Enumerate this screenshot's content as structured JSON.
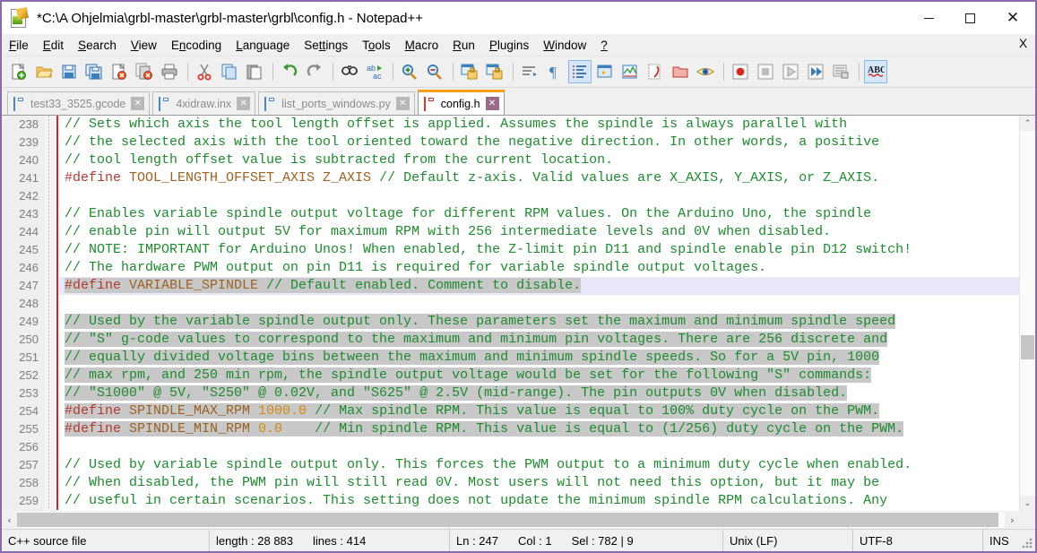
{
  "window": {
    "title": "*C:\\A Ohjelmia\\grbl-master\\grbl-master\\grbl\\config.h - Notepad++",
    "icon": "notepad-plus-plus-icon",
    "minimize_label": "—",
    "maximize_label": "□",
    "close_label": "✕"
  },
  "menu": {
    "items": [
      {
        "label": "File",
        "accel": "F"
      },
      {
        "label": "Edit",
        "accel": "E"
      },
      {
        "label": "Search",
        "accel": "S"
      },
      {
        "label": "View",
        "accel": "V"
      },
      {
        "label": "Encoding",
        "accel": "n"
      },
      {
        "label": "Language",
        "accel": "L"
      },
      {
        "label": "Settings",
        "accel": "t"
      },
      {
        "label": "Tools",
        "accel": "o"
      },
      {
        "label": "Macro",
        "accel": "M"
      },
      {
        "label": "Run",
        "accel": "R"
      },
      {
        "label": "Plugins",
        "accel": "P"
      },
      {
        "label": "Window",
        "accel": "W"
      },
      {
        "label": "?",
        "accel": "?"
      }
    ],
    "close_doc_label": "X"
  },
  "toolbar": {
    "buttons": [
      {
        "name": "new-file-icon",
        "tip": "New"
      },
      {
        "name": "open-file-icon",
        "tip": "Open"
      },
      {
        "name": "save-icon",
        "tip": "Save"
      },
      {
        "name": "save-all-icon",
        "tip": "Save All"
      },
      {
        "name": "close-file-icon",
        "tip": "Close"
      },
      {
        "name": "close-all-files-icon",
        "tip": "Close All"
      },
      {
        "name": "print-icon",
        "tip": "Print"
      },
      {
        "separator": true
      },
      {
        "name": "cut-icon",
        "tip": "Cut"
      },
      {
        "name": "copy-icon",
        "tip": "Copy"
      },
      {
        "name": "paste-icon",
        "tip": "Paste"
      },
      {
        "separator": true
      },
      {
        "name": "undo-icon",
        "tip": "Undo"
      },
      {
        "name": "redo-icon",
        "tip": "Redo"
      },
      {
        "separator": true
      },
      {
        "name": "find-icon",
        "tip": "Find"
      },
      {
        "name": "replace-icon",
        "tip": "Replace"
      },
      {
        "separator": true
      },
      {
        "name": "zoom-in-icon",
        "tip": "Zoom In"
      },
      {
        "name": "zoom-out-icon",
        "tip": "Zoom Out"
      },
      {
        "separator": true
      },
      {
        "name": "sync-vertical-scroll-icon",
        "tip": "Synchronize Vertical Scrolling"
      },
      {
        "name": "sync-horizontal-scroll-icon",
        "tip": "Synchronize Horizontal Scrolling"
      },
      {
        "separator": true
      },
      {
        "name": "word-wrap-icon",
        "tip": "Word wrap"
      },
      {
        "name": "show-all-characters-icon",
        "tip": "Show All Characters"
      },
      {
        "name": "show-indent-guide-icon",
        "tip": "Show Indent Guide",
        "active": true
      },
      {
        "name": "user-defined-dialog-icon",
        "tip": "UserDefine Dialogue"
      },
      {
        "name": "document-map-icon",
        "tip": "Document Map"
      },
      {
        "name": "function-list-icon",
        "tip": "Function List"
      },
      {
        "name": "folder-as-workspace-icon",
        "tip": "Folder as Workspace"
      },
      {
        "name": "monitoring-icon",
        "tip": "Monitoring"
      },
      {
        "separator": true
      },
      {
        "name": "record-macro-icon",
        "tip": "Start Recording"
      },
      {
        "name": "stop-macro-icon",
        "tip": "Stop Recording"
      },
      {
        "name": "play-macro-icon",
        "tip": "Playback"
      },
      {
        "name": "run-macro-multiple-icon",
        "tip": "Run a Macro Multiple Times"
      },
      {
        "name": "save-macro-icon",
        "tip": "Save Currently Recorded Macro"
      },
      {
        "separator": true
      },
      {
        "name": "spell-check-icon",
        "tip": "Spell Check",
        "active": true
      }
    ]
  },
  "tabs": [
    {
      "label": "test33_3525.gcode",
      "active": false,
      "icon": "blue-diskette-icon",
      "close": "✕"
    },
    {
      "label": "4xidraw.inx",
      "active": false,
      "icon": "blue-diskette-icon",
      "close": "✕"
    },
    {
      "label": "list_ports_windows.py",
      "active": false,
      "icon": "blue-diskette-icon",
      "close": "✕"
    },
    {
      "label": "config.h",
      "active": true,
      "icon": "red-diskette-icon",
      "close": "✕"
    }
  ],
  "editor": {
    "first_line_number": 238,
    "current_line": 247,
    "lines": [
      {
        "n": 238,
        "selected": false,
        "current": false,
        "parts": [
          {
            "c": "cmt",
            "t": "// Sets which axis the tool length offset is applied. Assumes the spindle is always parallel with"
          }
        ]
      },
      {
        "n": 239,
        "selected": false,
        "current": false,
        "parts": [
          {
            "c": "cmt",
            "t": "// the selected axis with the tool oriented toward the negative direction. In other words, a positive"
          }
        ]
      },
      {
        "n": 240,
        "selected": false,
        "current": false,
        "parts": [
          {
            "c": "cmt",
            "t": "// tool length offset value is subtracted from the current location."
          }
        ]
      },
      {
        "n": 241,
        "selected": false,
        "current": false,
        "parts": [
          {
            "c": "pre",
            "t": "#define "
          },
          {
            "c": "mac",
            "t": "TOOL_LENGTH_OFFSET_AXIS Z_AXIS "
          },
          {
            "c": "cmt",
            "t": "// Default z-axis. Valid values are X_AXIS, Y_AXIS, or Z_AXIS."
          }
        ]
      },
      {
        "n": 242,
        "selected": false,
        "current": false,
        "parts": []
      },
      {
        "n": 243,
        "selected": false,
        "current": false,
        "parts": [
          {
            "c": "cmt",
            "t": "// Enables variable spindle output voltage for different RPM values. On the Arduino Uno, the spindle"
          }
        ]
      },
      {
        "n": 244,
        "selected": false,
        "current": false,
        "parts": [
          {
            "c": "cmt",
            "t": "// enable pin will output 5V for maximum RPM with 256 intermediate levels and 0V when disabled."
          }
        ]
      },
      {
        "n": 245,
        "selected": false,
        "current": false,
        "parts": [
          {
            "c": "cmt",
            "t": "// NOTE: IMPORTANT for Arduino Unos! When enabled, the Z-limit pin D11 and spindle enable pin D12 switch!"
          }
        ]
      },
      {
        "n": 246,
        "selected": false,
        "current": false,
        "parts": [
          {
            "c": "cmt",
            "t": "// The hardware PWM output on pin D11 is required for variable spindle output voltages."
          }
        ]
      },
      {
        "n": 247,
        "selected": true,
        "current": true,
        "parts": [
          {
            "c": "pre",
            "t": "#define "
          },
          {
            "c": "mac",
            "t": "VARIABLE_SPINDLE "
          },
          {
            "c": "cmt",
            "t": "// Default enabled. Comment to disable."
          }
        ]
      },
      {
        "n": 248,
        "selected": false,
        "current": false,
        "parts": []
      },
      {
        "n": 249,
        "selected": true,
        "current": false,
        "parts": [
          {
            "c": "cmt",
            "t": "// Used by the variable spindle output only. These parameters set the maximum and minimum spindle speed"
          }
        ]
      },
      {
        "n": 250,
        "selected": true,
        "current": false,
        "parts": [
          {
            "c": "cmt",
            "t": "// \"S\" g-code values to correspond to the maximum and minimum pin voltages. There are 256 discrete and"
          }
        ]
      },
      {
        "n": 251,
        "selected": true,
        "current": false,
        "parts": [
          {
            "c": "cmt",
            "t": "// equally divided voltage bins between the maximum and minimum spindle speeds. So for a 5V pin, 1000"
          }
        ]
      },
      {
        "n": 252,
        "selected": true,
        "current": false,
        "parts": [
          {
            "c": "cmt",
            "t": "// max rpm, and 250 min rpm, the spindle output voltage would be set for the following \"S\" commands:"
          }
        ]
      },
      {
        "n": 253,
        "selected": true,
        "current": false,
        "parts": [
          {
            "c": "cmt",
            "t": "// \"S1000\" @ 5V, \"S250\" @ 0.02V, and \"S625\" @ 2.5V (mid-range). The pin outputs 0V when disabled."
          }
        ]
      },
      {
        "n": 254,
        "selected": true,
        "current": false,
        "parts": [
          {
            "c": "pre",
            "t": "#define "
          },
          {
            "c": "mac",
            "t": "SPINDLE_MAX_RPM "
          },
          {
            "c": "num",
            "t": "1000.0 "
          },
          {
            "c": "cmt",
            "t": "// Max spindle RPM. This value is equal to 100% duty cycle on the PWM."
          }
        ]
      },
      {
        "n": 255,
        "selected": true,
        "current": false,
        "parts": [
          {
            "c": "pre",
            "t": "#define "
          },
          {
            "c": "mac",
            "t": "SPINDLE_MIN_RPM "
          },
          {
            "c": "num",
            "t": "0.0    "
          },
          {
            "c": "cmt",
            "t": "// Min spindle RPM. This value is equal to (1/256) duty cycle on the PWM."
          }
        ]
      },
      {
        "n": 256,
        "selected": false,
        "current": false,
        "parts": []
      },
      {
        "n": 257,
        "selected": false,
        "current": false,
        "parts": [
          {
            "c": "cmt",
            "t": "// Used by variable spindle output only. This forces the PWM output to a minimum duty cycle when enabled."
          }
        ]
      },
      {
        "n": 258,
        "selected": false,
        "current": false,
        "parts": [
          {
            "c": "cmt",
            "t": "// When disabled, the PWM pin will still read 0V. Most users will not need this option, but it may be"
          }
        ]
      },
      {
        "n": 259,
        "selected": false,
        "current": false,
        "parts": [
          {
            "c": "cmt",
            "t": "// useful in certain scenarios. This setting does not update the minimum spindle RPM calculations. Any"
          }
        ]
      }
    ],
    "scroll_up_arrow": "⌃",
    "scroll_down_arrow": "⌄",
    "scroll_left_arrow": "‹",
    "scroll_right_arrow": "›"
  },
  "statusbar": {
    "file_type": "C++ source file",
    "length_label": "length : 28 883",
    "lines_label": "lines : 414",
    "ln_label": "Ln : 247",
    "col_label": "Col : 1",
    "sel_label": "Sel : 782 | 9",
    "eol": "Unix (LF)",
    "encoding": "UTF-8",
    "mode": "INS"
  },
  "colors": {
    "comment": "#1e8a2e",
    "preprocessor": "#b03a2e",
    "macro": "#9a6324",
    "number": "#d08b14",
    "selection": "#c8c8c8",
    "current_line": "#e8e8fa",
    "window_border": "#8a6aaf",
    "active_tab_top": "#ff9c1a"
  }
}
